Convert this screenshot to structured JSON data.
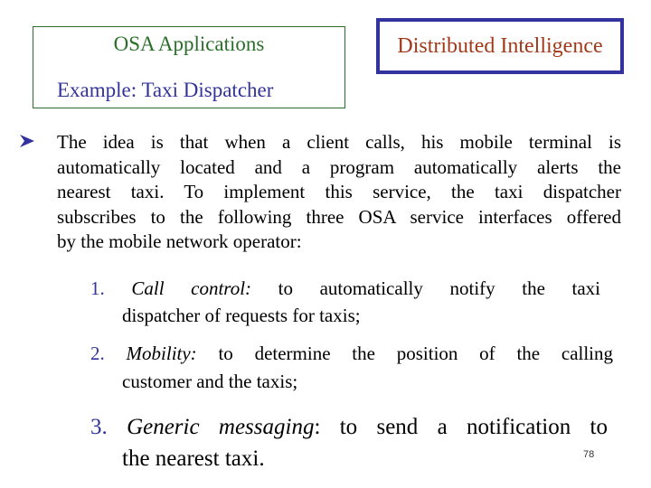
{
  "header": {
    "left_title": "OSA Applications",
    "left_subtitle": "Example: Taxi Dispatcher",
    "right_title": "Distributed Intelligence"
  },
  "body": {
    "bullet_icon": "arrowhead-bullet",
    "paragraph_lines": [
      " The idea is that when a client calls, his mobile terminal is",
      "automatically located and a program automatically alerts the",
      "nearest taxi. To implement this service, the taxi dispatcher",
      "subscribes to the following three OSA service interfaces offered",
      "by the mobile network operator:"
    ],
    "items": [
      {
        "number": "1.",
        "term": "Call control:",
        "line1": "to automatically notify the taxi",
        "line2": "dispatcher of requests for taxis;"
      },
      {
        "number": "2.",
        "term": "Mobility:",
        "line1": "to determine the position of the calling",
        "line2": "customer and  the taxis;"
      },
      {
        "number": "3.",
        "term": "Generic messaging",
        "line1": ": to send a notification to",
        "line2": "the nearest taxi."
      }
    ]
  },
  "footer": {
    "page_number": "78"
  },
  "colors": {
    "green_title": "#2a6e2a",
    "blue_subtitle": "#333399",
    "red_title": "#a03a1a",
    "blue_border": "#3333a0"
  }
}
